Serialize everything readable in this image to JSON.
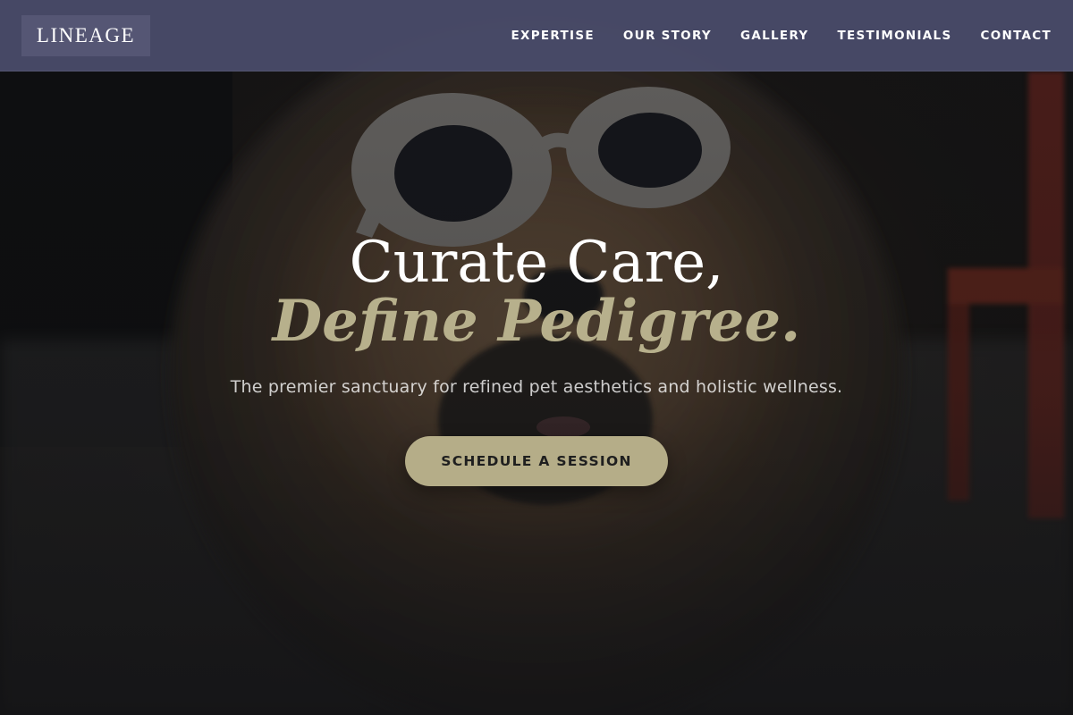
{
  "brand": {
    "logo_text": "LINEAGE"
  },
  "nav": {
    "items": [
      "EXPERTISE",
      "OUR STORY",
      "GALLERY",
      "TESTIMONIALS",
      "CONTACT"
    ]
  },
  "hero": {
    "headline_line1": "Curate Care,",
    "headline_line2": "Define Pedigree.",
    "subtitle": "The premier sanctuary for refined pet aesthetics and holistic wellness.",
    "cta_label": "SCHEDULE A SESSION",
    "image_subject": "fluffy-dog-wearing-white-sunglasses"
  },
  "colors": {
    "header_bg": "#484a68",
    "accent_gold": "#b5ad88",
    "headline_white": "#ffffff",
    "headline_italic": "#b7b08c"
  }
}
